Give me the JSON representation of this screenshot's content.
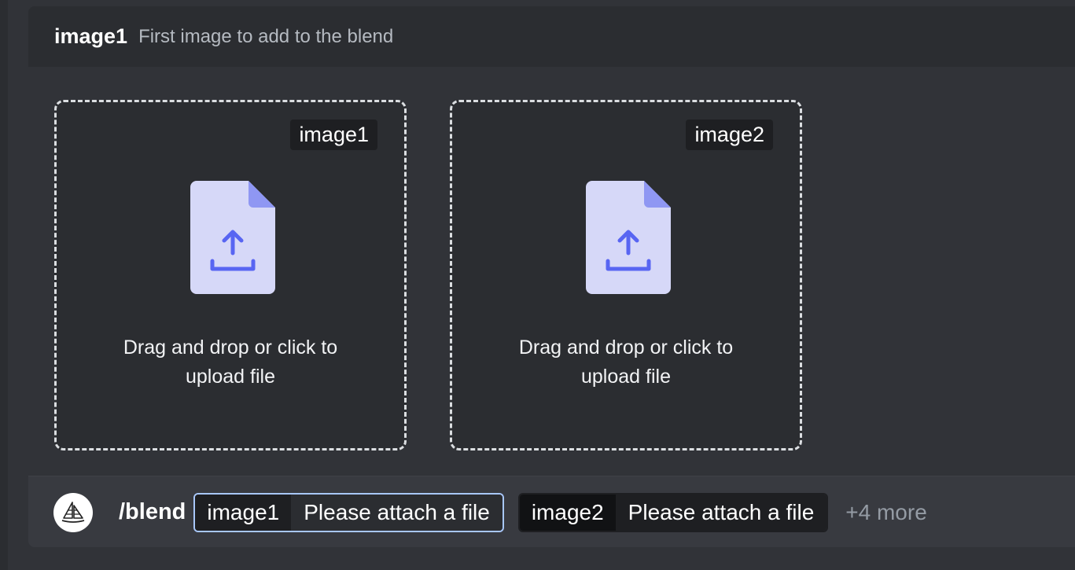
{
  "option": {
    "name": "image1",
    "description": "First image to add to the blend"
  },
  "dropzones": [
    {
      "badge": "image1",
      "text": "Drag and drop or click to upload file"
    },
    {
      "badge": "image2",
      "text": "Drag and drop or click to upload file"
    }
  ],
  "command": {
    "name": "/blend",
    "params": [
      {
        "key": "image1",
        "value": "Please attach a file"
      },
      {
        "key": "image2",
        "value": "Please attach a file"
      }
    ],
    "more": "+4 more"
  },
  "colors": {
    "background": "#313338",
    "header": "#2b2d31",
    "icon_fill": "#d6d8f8",
    "icon_accent": "#5865f2"
  }
}
